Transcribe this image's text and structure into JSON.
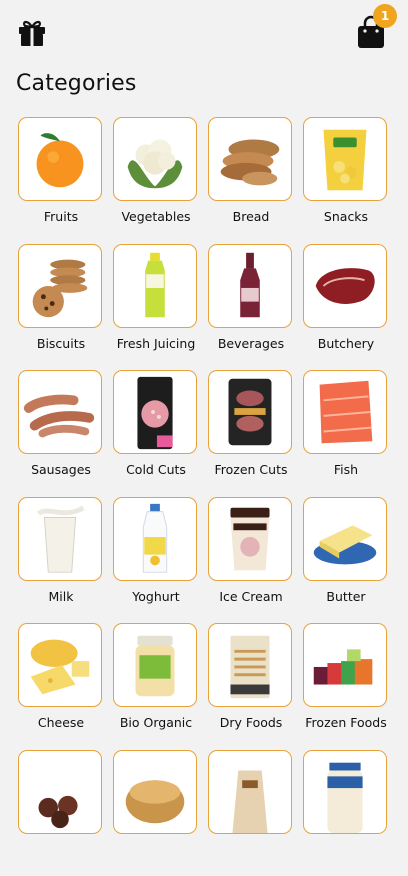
{
  "header": {
    "gift_icon": "gift-icon",
    "cart_icon": "shopping-bag-icon",
    "cart_count": "1",
    "accent": "#f0a51e"
  },
  "page": {
    "title": "Categories"
  },
  "categories": [
    {
      "label": "Fruits",
      "icon": "orange"
    },
    {
      "label": "Vegetables",
      "icon": "cauliflower"
    },
    {
      "label": "Bread",
      "icon": "bread"
    },
    {
      "label": "Snacks",
      "icon": "chips-bag"
    },
    {
      "label": "Biscuits",
      "icon": "cookies"
    },
    {
      "label": "Fresh Juicing",
      "icon": "juice-bottle"
    },
    {
      "label": "Beverages",
      "icon": "drink-bottle"
    },
    {
      "label": "Butchery",
      "icon": "steak"
    },
    {
      "label": "Sausages",
      "icon": "sausages"
    },
    {
      "label": "Cold Cuts",
      "icon": "salami-pack"
    },
    {
      "label": "Frozen Cuts",
      "icon": "burger-pack"
    },
    {
      "label": "Fish",
      "icon": "salmon"
    },
    {
      "label": "Milk",
      "icon": "milk-glass"
    },
    {
      "label": "Yoghurt",
      "icon": "yoghurt-bottle"
    },
    {
      "label": "Ice Cream",
      "icon": "ice-cream-tub"
    },
    {
      "label": "Butter",
      "icon": "butter-dish"
    },
    {
      "label": "Cheese",
      "icon": "cheese"
    },
    {
      "label": "Bio Organic",
      "icon": "baby-food-jar"
    },
    {
      "label": "Dry Foods",
      "icon": "pasta-pack"
    },
    {
      "label": "Frozen Foods",
      "icon": "frozen-veg"
    },
    {
      "label": "",
      "icon": "chocolates"
    },
    {
      "label": "",
      "icon": "cereal-bowl"
    },
    {
      "label": "",
      "icon": "paper-bag"
    },
    {
      "label": "",
      "icon": "mayo-jar"
    }
  ]
}
